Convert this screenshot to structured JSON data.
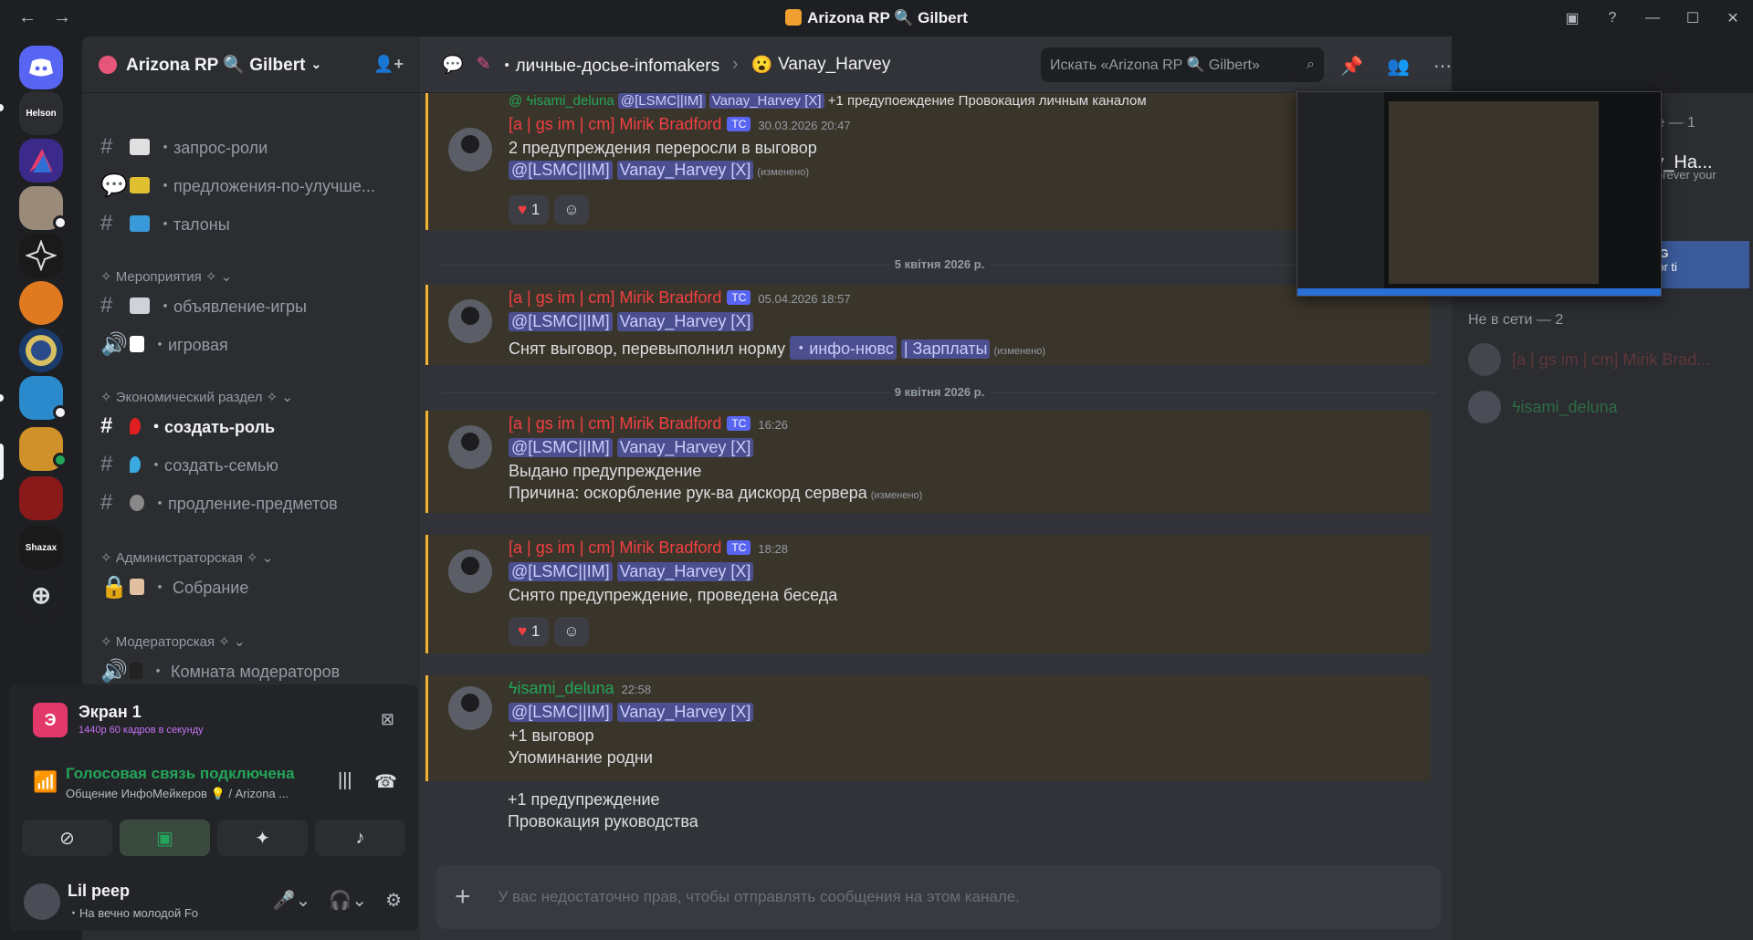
{
  "window": {
    "title": "Arizona RP 🔍 Gilbert"
  },
  "servers": [
    {
      "label": "",
      "color": "#5865f2"
    },
    {
      "label": "Helson",
      "color": "#2b2d31"
    },
    {
      "label": "",
      "color": "#3c2a8a"
    },
    {
      "label": "",
      "color": "#9a8a7a"
    },
    {
      "label": "",
      "color": "#1a1a1a"
    },
    {
      "label": "",
      "color": "#e07a20"
    },
    {
      "label": "",
      "color": "#1a3a6a"
    },
    {
      "label": "",
      "color": "#2a8acc"
    },
    {
      "label": "",
      "color": "#d0902a"
    },
    {
      "label": "",
      "color": "#8a1a1a"
    },
    {
      "label": "Shazax",
      "color": "#1a1a1a"
    }
  ],
  "guild": {
    "name": "Arizona RP 🔍 Gilbert"
  },
  "channels": [
    {
      "label": "・запрос-роли",
      "emoji_color": "#e0e0e0"
    },
    {
      "label": "・предложения-по-улучше...",
      "emoji_color": "#e0c030"
    },
    {
      "label": "・талоны",
      "emoji_color": "#3a9ad9"
    }
  ],
  "categories": {
    "events": "✧ Мероприятия ✧",
    "economy": "✧ Экономический раздел ✧",
    "admin": "✧ Администраторская ✧",
    "mod": "✧ Модераторская ✧"
  },
  "event_channels": [
    {
      "label": "・объявление-игры"
    },
    {
      "label": "・игровая"
    }
  ],
  "economy_channels": [
    {
      "label": "・создать-роль"
    },
    {
      "label": "・создать-семью"
    },
    {
      "label": "・продление-предметов"
    }
  ],
  "admin_channels": [
    {
      "label": "・ Собрание"
    }
  ],
  "mod_channels": [
    {
      "label": "・ Комната модераторов"
    }
  ],
  "stream": {
    "avatar_letter": "Э",
    "title": "Экран 1",
    "subtitle": "1440p 60 кадров в секунду"
  },
  "voice": {
    "title": "Голосовая связь подключена",
    "subtitle": "Общение ИнфоМейкеров 💡 / Arizona ..."
  },
  "user": {
    "name": "Lil peep",
    "status": "・На вечно молодой Fo"
  },
  "chat": {
    "breadcrumb_channel": "・личные-досье-infomakers",
    "breadcrumb_thread": "Vanay_Harvey",
    "search_placeholder": "Искать «Arizona RP 🔍 Gilbert»",
    "input_placeholder": "У вас недостаточно прав, чтобы отправлять сообщения на этом канале.",
    "reply_author": "@ ϟisami_deluna",
    "reply_mention": "@[LSMC||IM]",
    "reply_target": "Vanay_Harvey [X]",
    "reply_text": "+1 предупоеждение Провокация личным каналом",
    "author_name": "[a | gs im | cm] Mirik Bradford",
    "tag": "TC",
    "mention_role": "@[LSMC||IM]",
    "mention_user": "Vanay_Harvey [X]",
    "edited": "(изменено)",
    "divider1": "5 квітня 2026 р.",
    "divider2": "9 квітня 2026 р.",
    "msg1_ts": "30.03.2026 20:47",
    "msg1_text": "2 предупреждения переросли в выговор",
    "msg1_reaction": "1",
    "msg2_ts": "05.04.2026 18:57",
    "msg2_text": "Снят выговор, перевыполнил норму",
    "msg2_link1": "・инфо-нювс",
    "msg2_link2": "| Зарплаты",
    "msg3_ts": "16:26",
    "msg3_text1": "Выдано предупреждение",
    "msg3_text2": "Причина: оскорбление рук-ва дискорд сервера",
    "msg4_ts": "18:28",
    "msg4_text": "Снято предупреждение, проведена беседа",
    "msg4_reaction": "1",
    "msg5_author": "ϟisami_deluna",
    "msg5_ts": "22:58",
    "msg5_text1": "+1 выговор",
    "msg5_text2": "Упоминание родни",
    "msg5_text3": "+1 предупреждение",
    "msg5_text4": "Провокация руководства"
  },
  "members": {
    "online_header_partial": "ure — 1",
    "online_name_partial": "nay_Ha...",
    "online_status_partial": "Forever your",
    "badge_partial": "AG",
    "badge_sub_partial": "por ti",
    "offline_header": "Не в сети — 2",
    "offline1": "[a | gs im | cm] Mirik Brad...",
    "offline2": "ϟisami_deluna"
  },
  "colors": {
    "accent": "#5865f2",
    "online": "#23a55a",
    "author_red": "#f23f43",
    "highlight": "#f0b232"
  }
}
